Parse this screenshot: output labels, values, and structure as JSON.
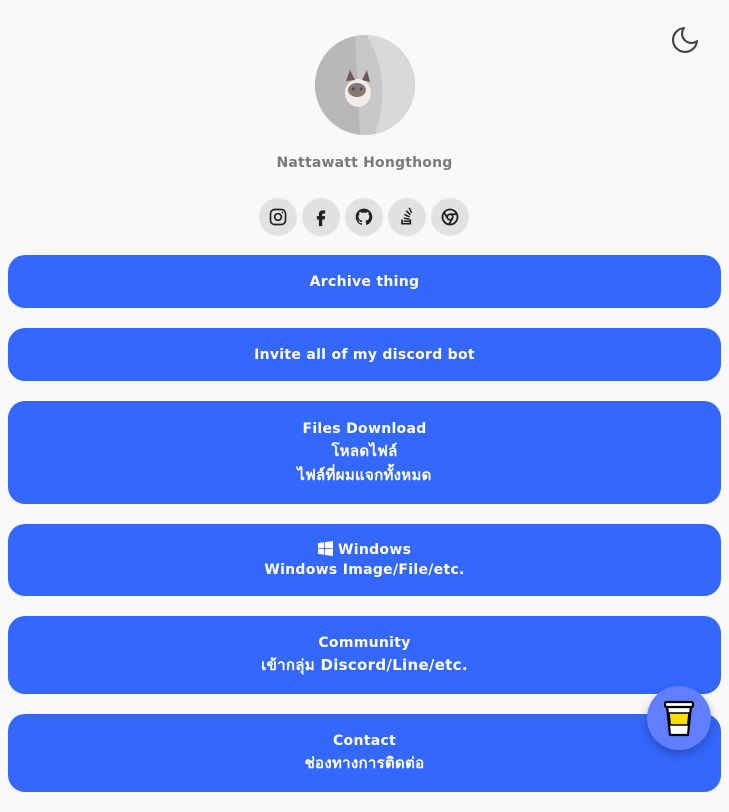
{
  "profile": {
    "name": "Nattawatt Hongthong"
  },
  "socials": [
    {
      "icon": "instagram-icon"
    },
    {
      "icon": "facebook-icon"
    },
    {
      "icon": "github-icon"
    },
    {
      "icon": "stackoverflow-icon"
    },
    {
      "icon": "chrome-icon"
    }
  ],
  "links": {
    "archive": "Archive thing",
    "discord_bot": "Invite all of my discord bot",
    "files_title": "Files Download",
    "files_thai_1": "โหลดไฟล์",
    "files_thai_2": "ไฟล์ที่ผมแจกทั้งหมด",
    "windows_title": "Windows",
    "windows_sub": "Windows Image/File/etc.",
    "community_title": "Community",
    "community_sub": "เข้ากลุ่ม Discord/Line/etc.",
    "contact_title": "Contact",
    "contact_sub": "ช่องทางการติดต่อ"
  },
  "colors": {
    "button": "#3467fc",
    "background": "#f9f9f9",
    "bmc": "#5f7fff"
  }
}
